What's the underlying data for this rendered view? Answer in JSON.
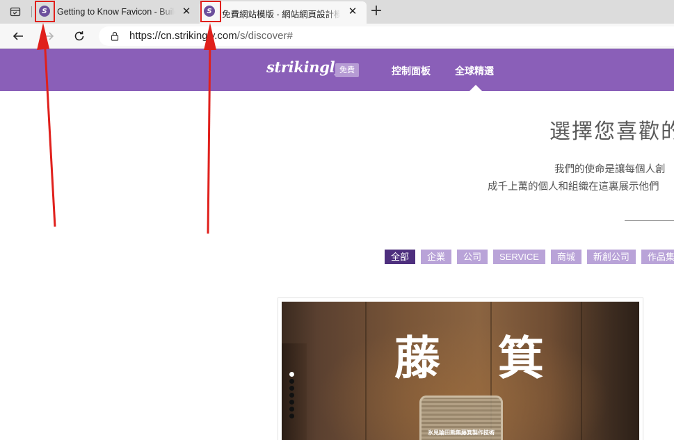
{
  "browser": {
    "tabs": [
      {
        "title": "Getting to Know Favicon - Building a Personal Brand",
        "favicon": "S",
        "active": false
      },
      {
        "title": "免費網站模版 - 網站網頁設計模板",
        "favicon": "S",
        "active": true
      }
    ],
    "url_host": "https://cn.strikingly.com",
    "url_path": "/s/discover#",
    "icons": {
      "tab_actions": "tab-actions-icon",
      "close": "close-icon",
      "new_tab": "plus-icon",
      "back": "back-arrow-icon",
      "forward": "forward-arrow-icon",
      "refresh": "refresh-icon",
      "lock": "lock-icon"
    },
    "close_glyph": "✕",
    "new_tab_glyph": "+"
  },
  "site_header": {
    "logo": "strikingly",
    "badge": "免費",
    "nav": [
      {
        "label": "控制面板",
        "active": false
      },
      {
        "label": "全球精選",
        "active": true
      }
    ],
    "color": "#8a5fb8"
  },
  "hero": {
    "title": "選擇您喜歡的",
    "mission_line_1": "我們的使命是讓每個人創",
    "mission_line_2": "成千上萬的個人和組織在這裏展示他們"
  },
  "filters": [
    {
      "label": "全部",
      "active": true
    },
    {
      "label": "企業",
      "active": false
    },
    {
      "label": "公司",
      "active": false
    },
    {
      "label": "SERVICE",
      "active": false
    },
    {
      "label": "商城",
      "active": false
    },
    {
      "label": "新創公司",
      "active": false
    },
    {
      "label": "作品集",
      "active": false
    }
  ],
  "featured_card": {
    "title": "藤 箕",
    "subtitle": "氷見論田熊無藤箕製作技術",
    "slide_count": 7,
    "active_slide": 1
  },
  "annotation": {
    "color": "#e0201c"
  }
}
